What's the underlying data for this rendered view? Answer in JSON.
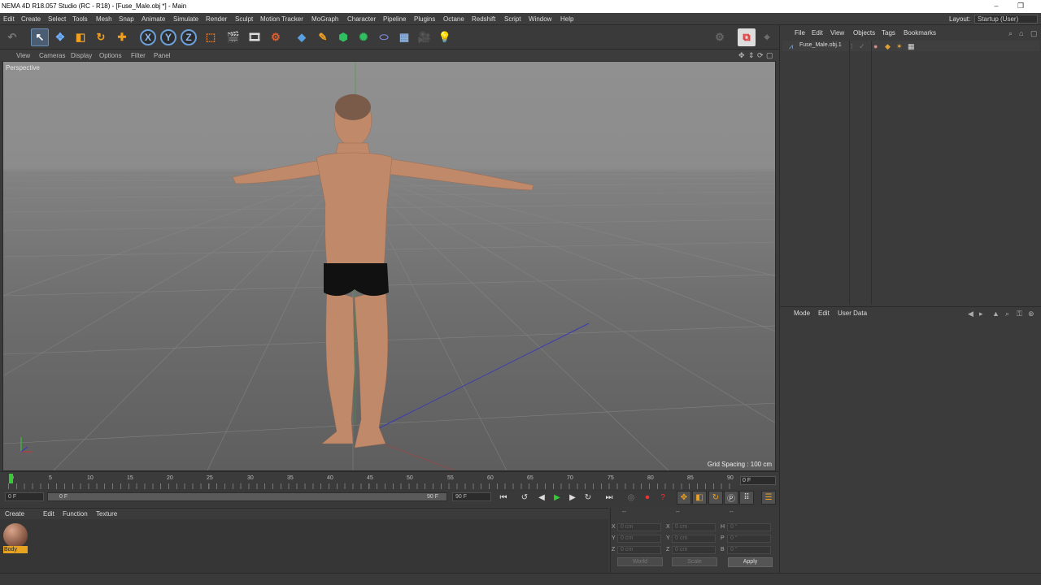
{
  "window": {
    "title": "NEMA 4D R18.057 Studio (RC - R18) - [Fuse_Male.obj *] - Main",
    "minimize_glyph": "–",
    "restore_glyph": "❐"
  },
  "menu": [
    "Edit",
    "Create",
    "Select",
    "Tools",
    "Mesh",
    "Snap",
    "Animate",
    "Simulate",
    "Render",
    "Sculpt",
    "Motion Tracker",
    "MoGraph",
    "Character",
    "Pipeline",
    "Plugins",
    "Octane",
    "Redshift",
    "Script",
    "Window",
    "Help"
  ],
  "layout": {
    "label": "Layout:",
    "value": "Startup (User)"
  },
  "viewport": {
    "menu": [
      "View",
      "Cameras",
      "Display",
      "Options",
      "Filter",
      "Panel"
    ],
    "label": "Perspective",
    "grid_spacing": "Grid Spacing : 100 cm"
  },
  "toolbar": {
    "axis_x": "X",
    "axis_y": "Y",
    "axis_z": "Z"
  },
  "timeline": {
    "ticks": [
      "0",
      "5",
      "10",
      "15",
      "20",
      "25",
      "30",
      "35",
      "40",
      "45",
      "50",
      "55",
      "60",
      "65",
      "70",
      "75",
      "80",
      "85",
      "90"
    ],
    "current_frame": "0 F",
    "start_field": "0 F",
    "slider_start": "0 F",
    "slider_end": "90 F",
    "end_field": "90 F",
    "playhead_fraction": 0
  },
  "material_manager": {
    "menu": [
      "Create",
      "Edit",
      "Function",
      "Texture"
    ],
    "materials": [
      {
        "name": "Body"
      }
    ]
  },
  "coordinates": {
    "header_left": "--",
    "header_mid": "--",
    "header_right": "--",
    "pos_labels": [
      "X",
      "Y",
      "Z"
    ],
    "pos_values": [
      "0 cm",
      "0 cm",
      "0 cm"
    ],
    "size_labels": [
      "X",
      "Y",
      "Z"
    ],
    "size_values": [
      "0 cm",
      "0 cm",
      "0 cm"
    ],
    "rot_labels": [
      "H",
      "P",
      "B"
    ],
    "rot_values": [
      "0 °",
      "0 °",
      "0 °"
    ],
    "world_btn": "World",
    "scale_btn": "Scale",
    "apply_btn": "Apply"
  },
  "object_manager": {
    "menu": [
      "File",
      "Edit",
      "View",
      "Objects",
      "Tags",
      "Bookmarks"
    ],
    "objects": [
      {
        "name": "Fuse_Male.obj.1"
      }
    ]
  },
  "attribute_manager": {
    "menu": [
      "Mode",
      "Edit",
      "User Data"
    ]
  },
  "colors": {
    "accent_blue": "#6a9fd9",
    "material_tag": "#e8a321",
    "playhead": "#33cc33"
  }
}
